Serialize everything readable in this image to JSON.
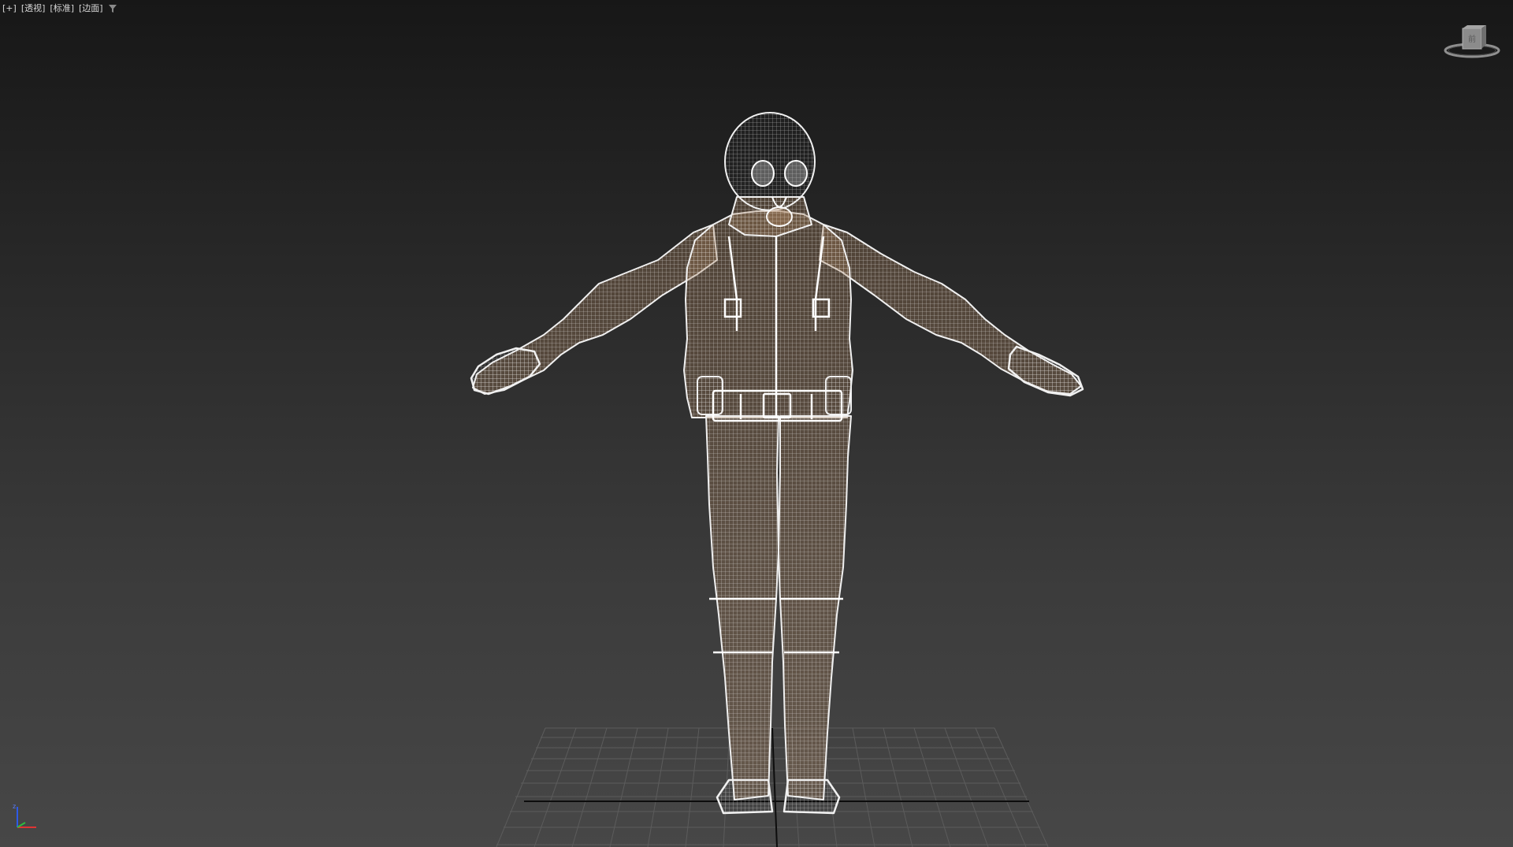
{
  "viewport": {
    "label_plus": "[+]",
    "label_view": "[透视]",
    "label_shading_standard": "[标准]",
    "label_shading_mode": "[边面]",
    "filter_icon": "funnel-filter-icon",
    "viewcube_icon": "viewcube-icon",
    "axis_icon": "xyz-axis-tripod-icon",
    "axis_x_label": "",
    "axis_z_label": "z"
  },
  "scene": {
    "object": "wireframe-character-gasmask-suit",
    "grid": true,
    "colors": {
      "wire": "#eeeeee",
      "skin_tint": "#b08760",
      "grid_line": "#5c5c5c",
      "grid_axis": "#0d0d0d",
      "bg_top": "#171717",
      "bg_bottom": "#474747"
    }
  }
}
